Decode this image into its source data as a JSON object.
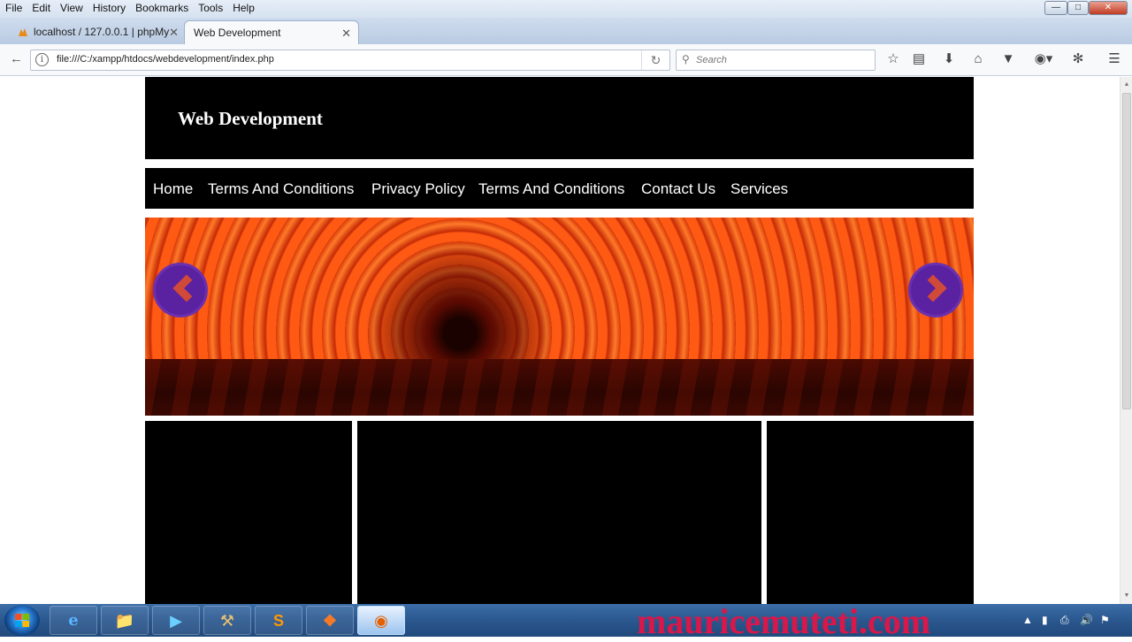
{
  "menubar": {
    "items": [
      "File",
      "Edit",
      "View",
      "History",
      "Bookmarks",
      "Tools",
      "Help"
    ]
  },
  "tabs": [
    {
      "title": "localhost / 127.0.0.1 | phpMy",
      "active": false
    },
    {
      "title": "Web Development",
      "active": true
    }
  ],
  "address_bar": {
    "url": "file:///C:/xampp/htdocs/webdevelopment/index.php"
  },
  "search": {
    "placeholder": "Search"
  },
  "page": {
    "site_title": "Web Development",
    "nav_links": [
      "Home",
      "Terms And Conditions",
      "Privacy Policy",
      "Terms And Conditions",
      "Contact Us",
      "Services"
    ]
  },
  "icons": {
    "back": "back-arrow-icon",
    "info": "info-icon",
    "reload": "reload-icon",
    "search": "search-icon",
    "bookmark": "star-icon",
    "library": "reading-list-icon",
    "downloads": "download-icon",
    "home": "home-icon",
    "pocket": "pocket-icon",
    "addon": "adblock-icon",
    "sync": "sync-icon",
    "menu": "hamburger-menu-icon"
  },
  "taskbar": {
    "watermark": "mauricemuteti.com",
    "apps": [
      "internet-explorer",
      "file-explorer",
      "media-player",
      "tool",
      "sublime-text",
      "xampp",
      "firefox"
    ]
  },
  "colors": {
    "site_black": "#000000",
    "slider_arrow": "#5a22a0",
    "watermark": "#d8174a"
  }
}
